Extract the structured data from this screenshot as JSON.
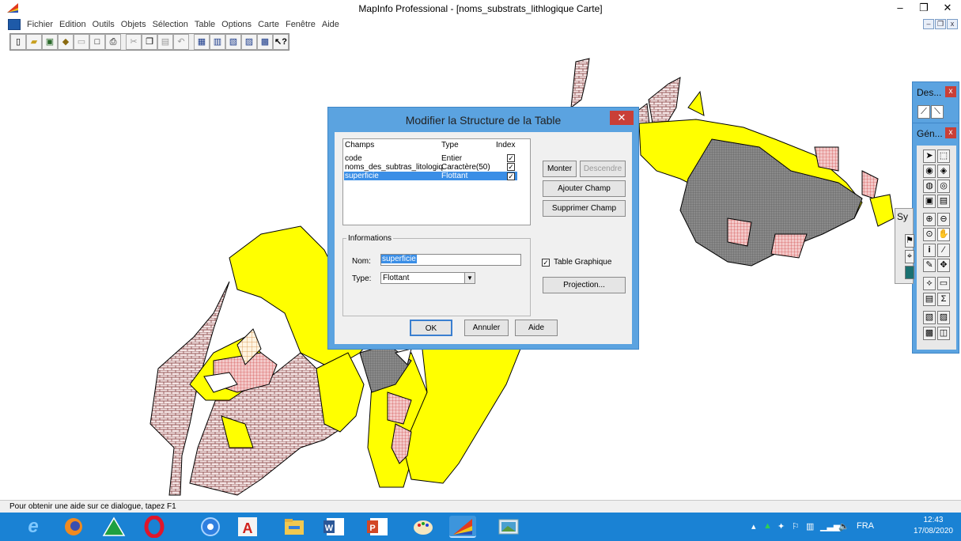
{
  "window": {
    "title": "MapInfo Professional - [noms_substrats_lithlogique Carte]",
    "minimize": "–",
    "restore": "❐",
    "close": "✕"
  },
  "menubar": {
    "items": [
      "Fichier",
      "Edition",
      "Outils",
      "Objets",
      "Sélection",
      "Table",
      "Options",
      "Carte",
      "Fenêtre",
      "Aide"
    ]
  },
  "toolbar": {
    "icons": [
      "new-icon",
      "open-icon",
      "open-workspace-icon",
      "save-icon",
      "save-as-icon",
      "close-icon",
      "print-icon",
      "cut-icon",
      "copy-icon",
      "paste-icon",
      "undo-icon",
      "new-browser-icon",
      "new-map-icon",
      "new-graph-icon",
      "new-layout-icon",
      "new-redistrict-icon",
      "help-icon"
    ]
  },
  "dialog": {
    "title": "Modifier la Structure de la Table",
    "close": "✕",
    "list_headers": {
      "name": "Champs",
      "type": "Type",
      "index": "Index"
    },
    "fields": [
      {
        "name": "code",
        "type": "Entier",
        "index": true,
        "selected": false
      },
      {
        "name": "noms_des_subtras_litologiq",
        "type": "Caractère(50)",
        "index": true,
        "selected": false
      },
      {
        "name": "superficie",
        "type": "Flottant",
        "index": true,
        "selected": true
      }
    ],
    "buttons": {
      "monter": "Monter",
      "descendre": "Descendre",
      "ajouter": "Ajouter Champ",
      "supprimer": "Supprimer Champ",
      "projection": "Projection...",
      "ok": "OK",
      "annuler": "Annuler",
      "aide": "Aide"
    },
    "informations": {
      "legend": "Informations",
      "nom_label": "Nom:",
      "nom_value": "superficie",
      "type_label": "Type:",
      "type_value": "Flottant"
    },
    "table_graphique": {
      "label": "Table Graphique",
      "checked": true
    }
  },
  "palettes": {
    "des": {
      "title": "Des...",
      "close": "x"
    },
    "gen": {
      "title": "Gén...",
      "close": "x"
    },
    "sy": {
      "title": "Sy"
    }
  },
  "statusbar": {
    "text": "Pour obtenir une aide sur ce dialogue, tapez F1"
  },
  "taskbar": {
    "apps": [
      "internet-explorer-icon",
      "firefox-icon",
      "green-triangle-app-icon",
      "opera-icon",
      "chrome-icon",
      "acrobat-icon",
      "file-explorer-icon",
      "word-icon",
      "powerpoint-icon",
      "paint-icon",
      "mapinfo-icon",
      "photos-icon"
    ],
    "language": "FRA",
    "time": "12:43",
    "date": "17/08/2020"
  },
  "colors": {
    "titlebar_active": "#5ba3e0",
    "taskbar": "#1a82d4",
    "selection": "#3a8ee6",
    "map_yellow": "#ffff00",
    "map_gray": "#707070",
    "map_red_hatch": "#d24a4a"
  }
}
